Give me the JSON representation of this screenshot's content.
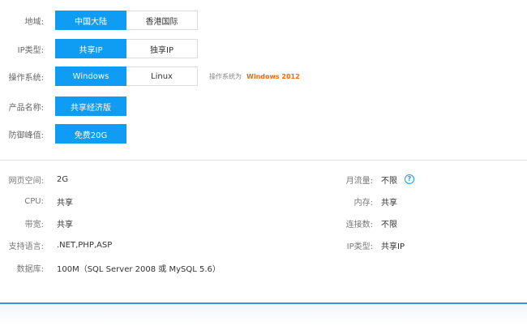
{
  "config": {
    "region": {
      "label": "地域:",
      "options": [
        "中国大陆",
        "香港国际"
      ],
      "selected": 0
    },
    "ip_type": {
      "label": "IP类型:",
      "options": [
        "共享IP",
        "独享IP"
      ],
      "selected": 0
    },
    "os": {
      "label": "操作系统:",
      "options": [
        "Windows",
        "Linux"
      ],
      "selected": 0,
      "hint_prefix": "操作系统为",
      "hint_value": "Windows 2012"
    },
    "product": {
      "label": "产品名称:",
      "options": [
        "共享经济版"
      ],
      "selected": 0
    },
    "ddos": {
      "label": "防御峰值:",
      "options": [
        "免费20G"
      ],
      "selected": 0
    }
  },
  "specs": {
    "left": [
      {
        "key": "网页空间:",
        "value": "2G"
      },
      {
        "key": "CPU:",
        "value": "共享"
      },
      {
        "key": "带宽:",
        "value": "共享"
      },
      {
        "key": "支持语言:",
        "value": ".NET,PHP,ASP"
      },
      {
        "key": "数据库:",
        "value": "100M（SQL Server 2008 或 MySQL 5.6）"
      }
    ],
    "right": [
      {
        "key": "月流量:",
        "value": "不限",
        "help_icon": "?"
      },
      {
        "key": "内存:",
        "value": "共享"
      },
      {
        "key": "连接数:",
        "value": "不限"
      },
      {
        "key": "IP类型:",
        "value": "共享IP"
      }
    ]
  },
  "colors": {
    "accent": "#0e9df3",
    "hint_value": "#ff6600"
  }
}
